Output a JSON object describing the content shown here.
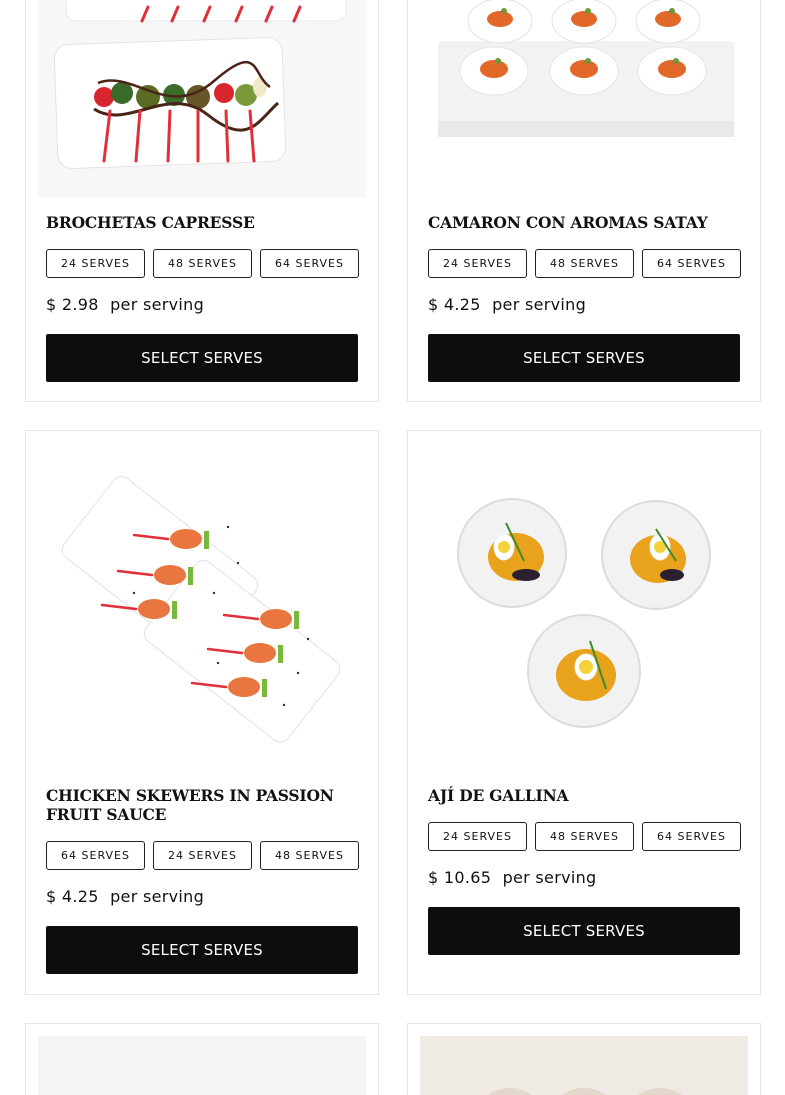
{
  "products": [
    {
      "title": "BROCHETAS CAPRESSE",
      "image_label": "brochetas-capresse-photo",
      "serves": [
        "24 SERVES",
        "48 SERVES",
        "64 SERVES"
      ],
      "price": "$ 2.98",
      "per": "per serving",
      "button": "SELECT SERVES"
    },
    {
      "title": "CAMARON CON AROMAS SATAY",
      "image_label": "camaron-satay-photo",
      "serves": [
        "24 SERVES",
        "48 SERVES",
        "64 SERVES"
      ],
      "price": "$ 4.25",
      "per": "per serving",
      "button": "SELECT SERVES"
    },
    {
      "title": "CHICKEN SKEWERS IN PASSION FRUIT SAUCE",
      "image_label": "chicken-skewers-photo",
      "serves": [
        "64 SERVES",
        "24 SERVES",
        "48 SERVES"
      ],
      "price": "$ 4.25",
      "per": "per serving",
      "button": "SELECT SERVES"
    },
    {
      "title": "AJÍ DE GALLINA",
      "image_label": "aji-de-gallina-photo",
      "serves": [
        "24 SERVES",
        "48 SERVES",
        "64 SERVES"
      ],
      "price": "$ 10.65",
      "per": "per serving",
      "button": "SELECT SERVES"
    }
  ],
  "colors": {
    "button_bg": "#0d0d0d",
    "border": "#e6e6e6",
    "accent_red": "#e0303a"
  }
}
